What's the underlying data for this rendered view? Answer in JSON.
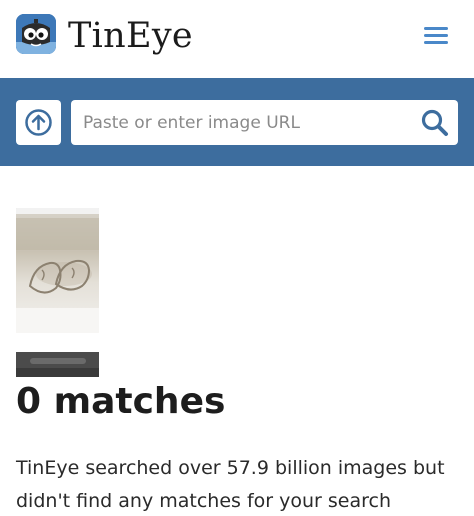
{
  "header": {
    "brand": "TinEye",
    "logo_icon": "tineye-robot-icon",
    "menu_icon": "hamburger-menu-icon"
  },
  "search": {
    "upload_icon": "upload-arrow-icon",
    "placeholder": "Paste or enter image URL",
    "value": "",
    "search_icon": "magnifier-icon"
  },
  "result": {
    "heading": "0 matches",
    "description": "TinEye searched over 57.9 billion images but didn't find any matches for your search"
  },
  "colors": {
    "band": "#3d6d9e",
    "accent": "#4a88c9",
    "logo_bg": "#3d78b8"
  }
}
